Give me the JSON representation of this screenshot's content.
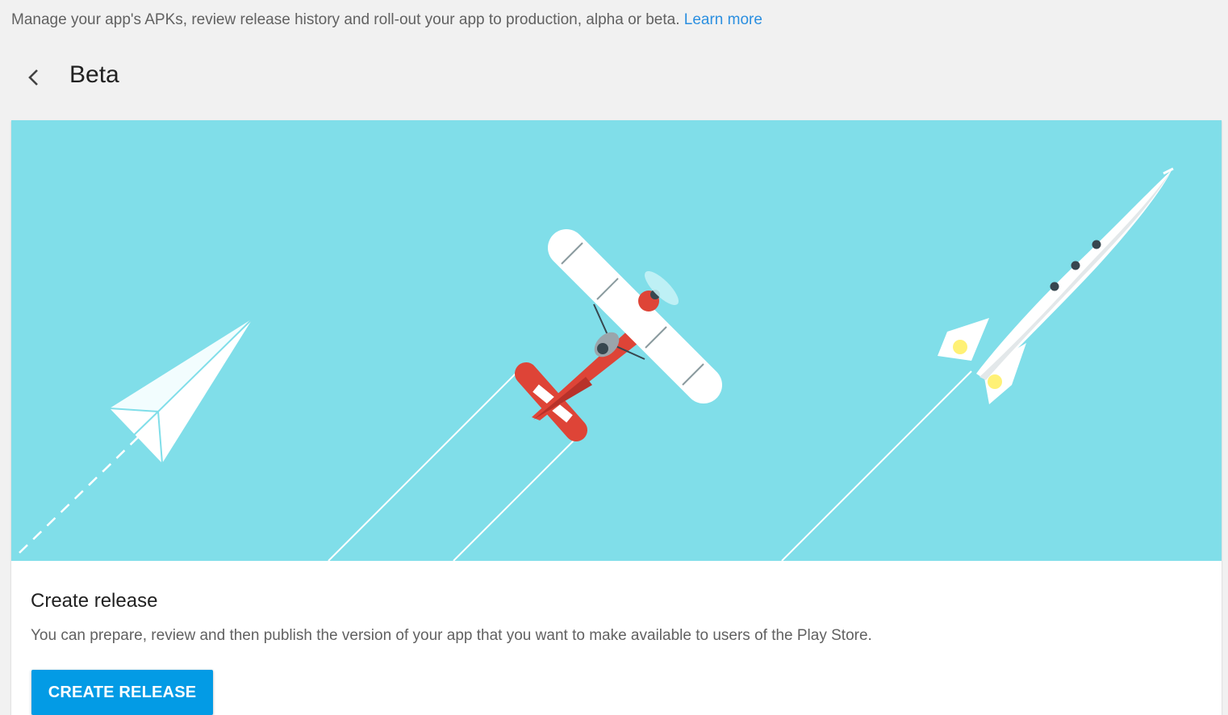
{
  "header": {
    "description": "Manage your app's APKs, review release history and roll-out your app to production, alpha or beta.",
    "learn_more": "Learn more"
  },
  "page": {
    "title": "Beta"
  },
  "card": {
    "heading": "Create release",
    "text": "You can prepare, review and then publish the version of your app that you want to make available to users of the Play Store.",
    "button_label": "CREATE RELEASE"
  },
  "icons": {
    "back": "chevron-left-icon",
    "illustration": [
      "paper-plane",
      "biplane",
      "rocket"
    ]
  },
  "colors": {
    "hero_background": "#80dee9",
    "button": "#039be5",
    "link": "#2b8fe0",
    "plane_red": "#de4437"
  }
}
